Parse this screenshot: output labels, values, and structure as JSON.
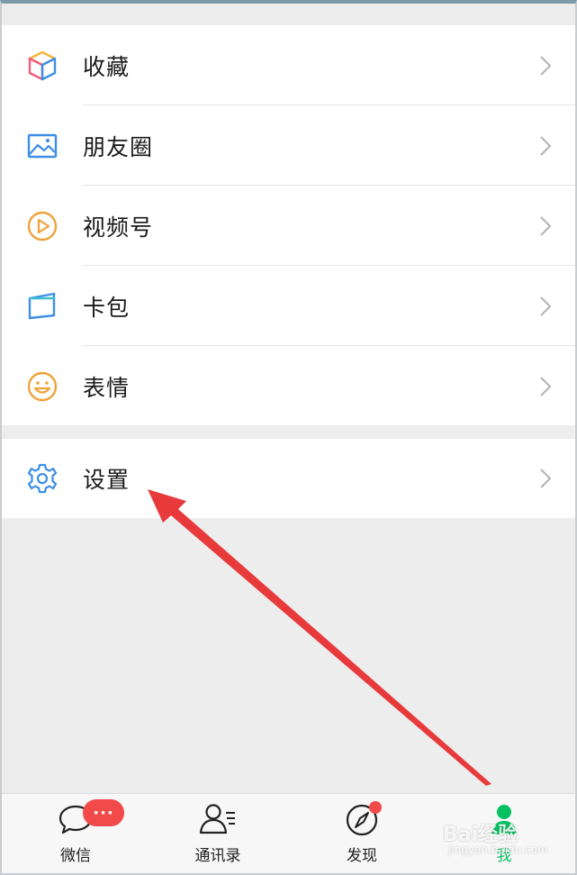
{
  "menu": {
    "items": [
      {
        "label": "收藏",
        "icon": "favorites-cube-icon"
      },
      {
        "label": "朋友圈",
        "icon": "moments-picture-icon"
      },
      {
        "label": "视频号",
        "icon": "channels-play-icon"
      },
      {
        "label": "卡包",
        "icon": "card-wallet-icon"
      },
      {
        "label": "表情",
        "icon": "sticker-smile-icon"
      }
    ],
    "settings": {
      "label": "设置",
      "icon": "gear-icon"
    }
  },
  "tabbar": {
    "tabs": [
      {
        "label": "微信",
        "badge": "···"
      },
      {
        "label": "通讯录"
      },
      {
        "label": "发现"
      },
      {
        "label": "我"
      }
    ],
    "active_color": "#07c160"
  },
  "watermark": {
    "text": "Bai经验",
    "sub": "jingyan.baidu.com"
  },
  "colors": {
    "annotation_arrow": "#e8393b",
    "badge": "#f2494a"
  }
}
